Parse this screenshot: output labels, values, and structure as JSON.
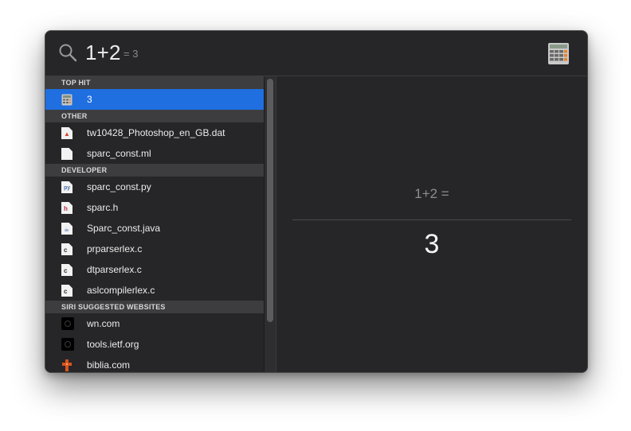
{
  "search": {
    "query": "1+2",
    "inline_result": "= 3"
  },
  "sections": [
    {
      "header": "TOP HIT",
      "items": [
        {
          "label": "3",
          "icon": "calculator-icon",
          "selected": true
        }
      ]
    },
    {
      "header": "OTHER",
      "items": [
        {
          "label": "tw10428_Photoshop_en_GB.dat",
          "icon": "photoshop-file-icon"
        },
        {
          "label": "sparc_const.ml",
          "icon": "document-icon"
        }
      ]
    },
    {
      "header": "DEVELOPER",
      "items": [
        {
          "label": "sparc_const.py",
          "icon": "python-file-icon"
        },
        {
          "label": "sparc.h",
          "icon": "header-file-icon"
        },
        {
          "label": "Sparc_const.java",
          "icon": "java-file-icon"
        },
        {
          "label": "prparserlex.c",
          "icon": "c-file-icon"
        },
        {
          "label": "dtparserlex.c",
          "icon": "c-file-icon"
        },
        {
          "label": "aslcompilerlex.c",
          "icon": "c-file-icon"
        }
      ]
    },
    {
      "header": "SIRI SUGGESTED WEBSITES",
      "items": [
        {
          "label": "wn.com",
          "icon": "website-icon"
        },
        {
          "label": "tools.ietf.org",
          "icon": "website-icon"
        },
        {
          "label": "biblia.com",
          "icon": "biblia-icon"
        }
      ]
    }
  ],
  "preview": {
    "expression": "1+2 =",
    "answer": "3"
  },
  "colors": {
    "selection": "#1f6fe0",
    "window_bg": "#262628",
    "section_header_bg": "#3d3d3f"
  }
}
